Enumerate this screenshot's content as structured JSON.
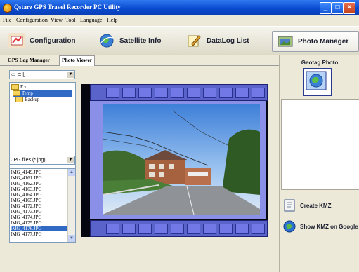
{
  "window": {
    "title": "Qstarz GPS Travel Recorder PC Utility"
  },
  "title_buttons": {
    "minimize": "_",
    "maximize": "□",
    "close": "×"
  },
  "menu": [
    "File",
    "Configuration",
    "View",
    "Tool",
    "Language",
    "Help"
  ],
  "toolbar": {
    "buttons": [
      {
        "label": "Configuration",
        "icon": "configuration-icon"
      },
      {
        "label": "Satellite Info",
        "icon": "satellite-globe-icon"
      },
      {
        "label": "DataLog List",
        "icon": "datalog-pencil-icon"
      },
      {
        "label": "Photo Manager",
        "icon": "photo-manager-icon",
        "active": true
      }
    ]
  },
  "tabs": [
    {
      "label": "GPS Log Manager",
      "active": false
    },
    {
      "label": "Photo Viewer",
      "active": true
    }
  ],
  "drive_select": {
    "value": "e: []"
  },
  "folder_tree": [
    {
      "label": "E:\\",
      "selected": false
    },
    {
      "label": "Temp",
      "selected": true
    },
    {
      "label": "Backup",
      "selected": false
    }
  ],
  "file_type_select": {
    "value": "JPG files (*.jpg)"
  },
  "file_list": [
    "IMG_4149.JPG",
    "IMG_4161.JPG",
    "IMG_4162.JPG",
    "IMG_4163.JPG",
    "IMG_4164.JPG",
    "IMG_4165.JPG",
    "IMG_4172.JPG",
    "IMG_4173.JPG",
    "IMG_4174.JPG",
    "IMG_4175.JPG",
    "IMG_4176.JPG",
    "IMG_4177.JPG"
  ],
  "selected_file": "IMG_4176.JPG",
  "right_panel": {
    "geotag_label": "Geotag Photo",
    "create_kmz_label": "Create KMZ",
    "show_kmz_label": "Show KMZ on Google"
  },
  "colors": {
    "titlebar": "#0a4bd0",
    "selection": "#316ac5",
    "film": "#5a63c9"
  }
}
